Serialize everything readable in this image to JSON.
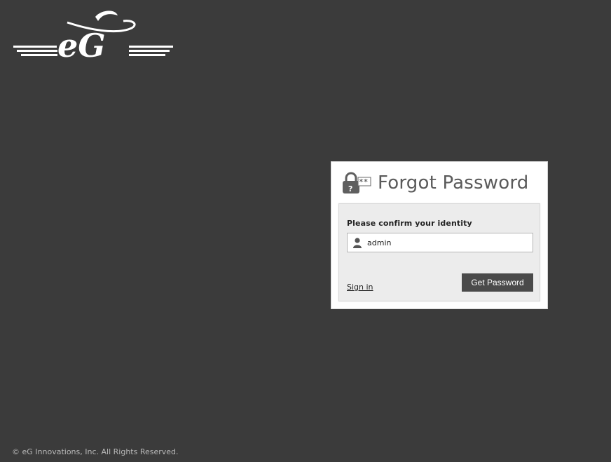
{
  "logo": {
    "text": "eG",
    "icon": "eg-logo-icon"
  },
  "forgot_password": {
    "title": "Forgot Password",
    "icon": "lock-password-icon",
    "identity_label": "Please confirm your identity",
    "username_value": "admin",
    "user_icon": "user-icon",
    "sign_in_label": "Sign in",
    "get_password_label": "Get Password"
  },
  "footer": {
    "copyright": "© eG Innovations, Inc. All Rights Reserved."
  },
  "colors": {
    "background": "#3b3b3b",
    "panel": "#ffffff",
    "inner_panel": "#ececec",
    "button": "#4a4a4a",
    "title": "#5a5a5a",
    "footer_text": "#b8b8b8"
  }
}
